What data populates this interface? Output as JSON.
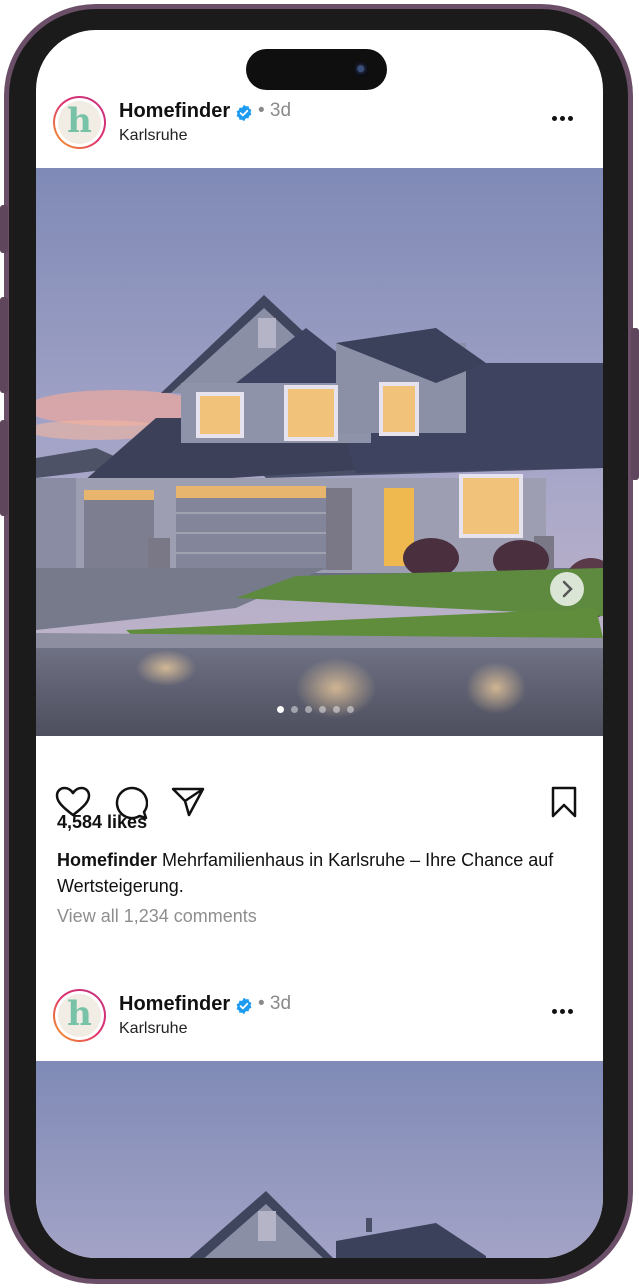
{
  "posts": [
    {
      "username": "Homefinder",
      "verified": true,
      "time": "• 3d",
      "location": "Karlsruhe",
      "avatar_letter": "h",
      "carousel": {
        "count": 6,
        "active_index": 0
      },
      "likes": "4,584 likes",
      "caption_user": "Homefinder",
      "caption_text": " Mehrfamilienhaus in Karlsruhe – Ihre Chance auf Wertsteigerung.",
      "comments_link": "View all 1,234 comments"
    },
    {
      "username": "Homefinder",
      "verified": true,
      "time": "• 3d",
      "location": "Karlsruhe",
      "avatar_letter": "h"
    }
  ],
  "icons": {
    "like": "heart-icon",
    "comment": "comment-icon",
    "share": "paper-plane-icon",
    "save": "bookmark-icon",
    "more": "more-horizontal-icon",
    "verified": "verified-badge-icon",
    "next": "chevron-right-icon"
  },
  "colors": {
    "verified_blue": "#1d9bf0",
    "text_primary": "#111111",
    "text_secondary": "#8e8e8e",
    "phone_frame": "#6b4f68"
  }
}
